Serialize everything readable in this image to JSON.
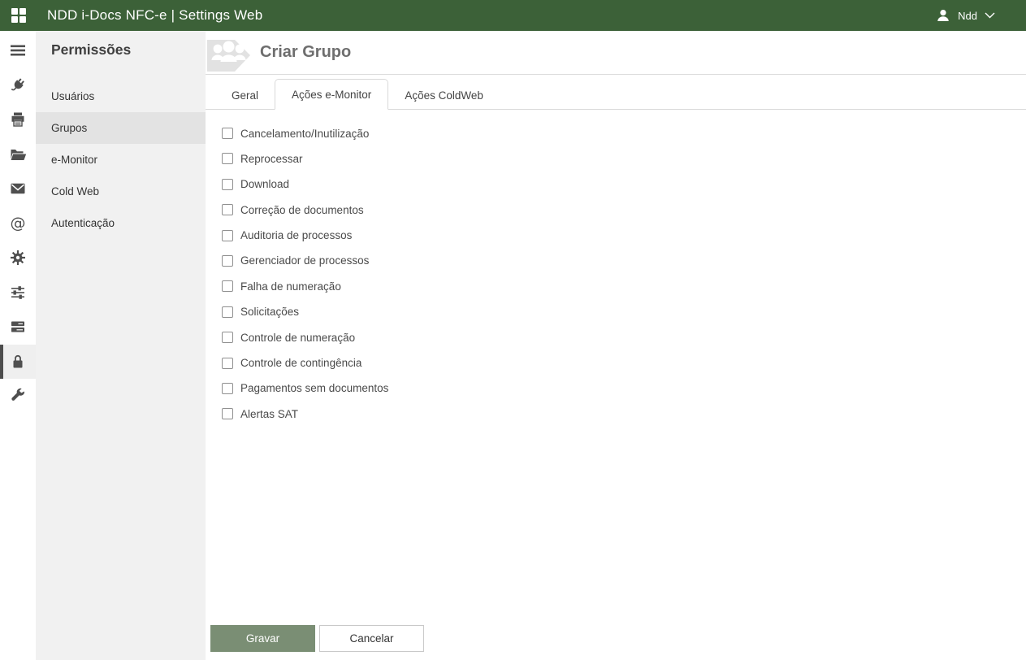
{
  "topbar": {
    "title": "NDD i-Docs NFC-e | Settings Web",
    "logo_icon": "apps-grid-icon",
    "user": {
      "name": "Ndd",
      "icon": "person-icon",
      "dropdown_icon": "chevron-down-icon"
    }
  },
  "iconbar": {
    "items": [
      {
        "name": "menu",
        "icon": "hamburger-icon",
        "active": false
      },
      {
        "name": "plug",
        "icon": "plug-icon",
        "active": false
      },
      {
        "name": "printer",
        "icon": "printer-icon",
        "active": false
      },
      {
        "name": "folder",
        "icon": "folder-open-icon",
        "active": false
      },
      {
        "name": "mail",
        "icon": "envelope-icon",
        "active": false
      },
      {
        "name": "at-sign",
        "icon": "at-sign-icon",
        "active": false
      },
      {
        "name": "settings",
        "icon": "gear-icon",
        "active": false
      },
      {
        "name": "sliders",
        "icon": "sliders-icon",
        "active": false
      },
      {
        "name": "server",
        "icon": "server-icon",
        "active": false
      },
      {
        "name": "security",
        "icon": "lock-icon",
        "active": true
      },
      {
        "name": "tools",
        "icon": "wrench-icon",
        "active": false
      }
    ]
  },
  "sidebar": {
    "title": "Permissões",
    "items": [
      {
        "label": "Usuários",
        "active": false
      },
      {
        "label": "Grupos",
        "active": true
      },
      {
        "label": "e-Monitor",
        "active": false
      },
      {
        "label": "Cold Web",
        "active": false
      },
      {
        "label": "Autenticação",
        "active": false
      }
    ]
  },
  "main": {
    "title": "Criar Grupo",
    "header_icon": "group-people-icon",
    "tabs": [
      {
        "label": "Geral",
        "active": false
      },
      {
        "label": "Ações e-Monitor",
        "active": true
      },
      {
        "label": "Ações ColdWeb",
        "active": false
      }
    ],
    "checkboxes": [
      "Cancelamento/Inutilização",
      "Reprocessar",
      "Download",
      "Correção de documentos",
      "Auditoria de processos",
      "Gerenciador de processos",
      "Falha de numeração",
      "Solicitações",
      "Controle de numeração",
      "Controle de contingência",
      "Pagamentos sem documentos",
      "Alertas SAT"
    ],
    "checkbox_states": [
      false,
      false,
      false,
      false,
      false,
      false,
      false,
      false,
      false,
      false,
      false,
      false
    ],
    "buttons": {
      "save": "Gravar",
      "cancel": "Cancelar"
    }
  },
  "colors": {
    "topbar_green": "#3c6138",
    "save_button_green": "#7a8e74",
    "sidebar_bg": "#f1f1f1",
    "sidebar_selected_bg": "#e3e3e3",
    "active_rail_marker": "#4d4d4d"
  }
}
